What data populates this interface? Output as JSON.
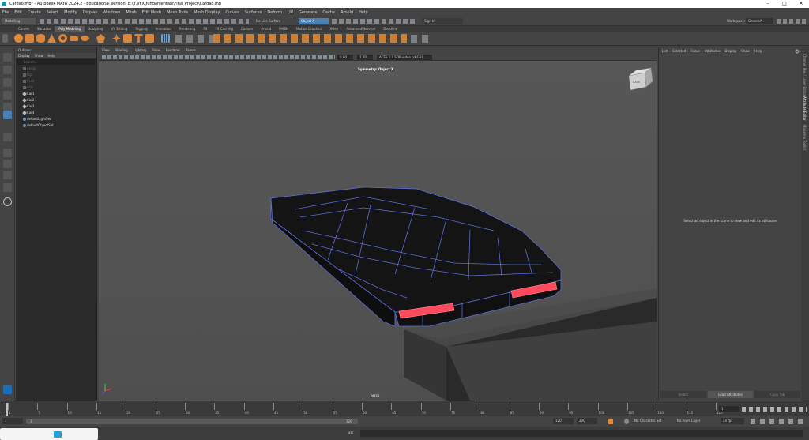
{
  "window": {
    "title": "Cardao.mb* - Autodesk MAYA 2024.2 - Educational Version: E:\\3.VFX\\fundamentals\\Final Project\\Cardao.mb",
    "controls": [
      "–",
      "□",
      "✕"
    ]
  },
  "menubar": [
    "File",
    "Edit",
    "Create",
    "Select",
    "Modify",
    "Display",
    "Windows",
    "Mesh",
    "Edit Mesh",
    "Mesh Tools",
    "Mesh Display",
    "Curves",
    "Surfaces",
    "Deform",
    "UV",
    "Generate",
    "Cache",
    "Arnold",
    "Help"
  ],
  "statusline": {
    "mode": "Modelling",
    "live_surface": "No Live Surface",
    "symmetry": "Object X",
    "sign_in": "Sign In",
    "workspace_label": "Workspace:",
    "workspace_value": "General*"
  },
  "shelf": {
    "tabs": [
      "Curves",
      "Surfaces",
      "Poly Modeling",
      "Sculpting",
      "UV Editing",
      "Rigging",
      "Animation",
      "Rendering",
      "FX",
      "FX Caching",
      "Custom",
      "Arnold",
      "MASH",
      "Motion Graphics",
      "XGen",
      "AdvancedSkeleton",
      "Deadline"
    ],
    "active_tab": "Poly Modeling"
  },
  "outliner": {
    "title": "Outliner",
    "menus": [
      "Display",
      "Show",
      "Help"
    ],
    "search_placeholder": "Search...",
    "items": [
      {
        "label": "persp",
        "dim": true
      },
      {
        "label": "top",
        "dim": true
      },
      {
        "label": "front",
        "dim": true
      },
      {
        "label": "side",
        "dim": true
      },
      {
        "label": "Car1",
        "dim": false
      },
      {
        "label": "Car2",
        "dim": false
      },
      {
        "label": "Car3",
        "dim": false
      },
      {
        "label": "Car4",
        "dim": false
      },
      {
        "label": "defaultLightSet",
        "dim": false
      },
      {
        "label": "defaultObjectSet",
        "dim": false
      }
    ]
  },
  "viewport": {
    "menus": [
      "View",
      "Shading",
      "Lighting",
      "Show",
      "Renderer",
      "Panels"
    ],
    "near_value": "0.00",
    "far_value": "1.00",
    "colorspace": "ACES 1.0 SDR-video (sRGB)",
    "symmetry_label": "Symmetry: Object X",
    "camera_label": "persp",
    "viewcube_label": "BACK",
    "accent_edge": "#5b6cd8",
    "light_color": "#ff4a5e"
  },
  "attribute_editor": {
    "menus": [
      "List",
      "Selected",
      "Focus",
      "Attributes",
      "Display",
      "Show",
      "Help"
    ],
    "message": "Select an object in the scene to view and edit its attributes",
    "buttons": [
      "Select",
      "Load Attributes",
      "Copy Tab"
    ],
    "side_tabs": [
      "Channel Box / Layer Editor",
      "Attribute Editor",
      "Modeling Toolkit"
    ]
  },
  "timeline": {
    "ticks": [
      "1",
      "5",
      "10",
      "15",
      "20",
      "25",
      "30",
      "35",
      "40",
      "45",
      "50",
      "55",
      "60",
      "65",
      "70",
      "75",
      "80",
      "85",
      "90",
      "95",
      "100",
      "105",
      "110",
      "115",
      "120"
    ],
    "current_frame": "1",
    "range_start": "1",
    "range_inner_start": "1",
    "range_inner_end": "120",
    "range_end_a": "120",
    "range_end_b": "200",
    "character_set": "No Character Set",
    "anim_layer": "No Anim Layer",
    "fps": "24 fps"
  },
  "cmdline": {
    "lang": "MEL"
  }
}
